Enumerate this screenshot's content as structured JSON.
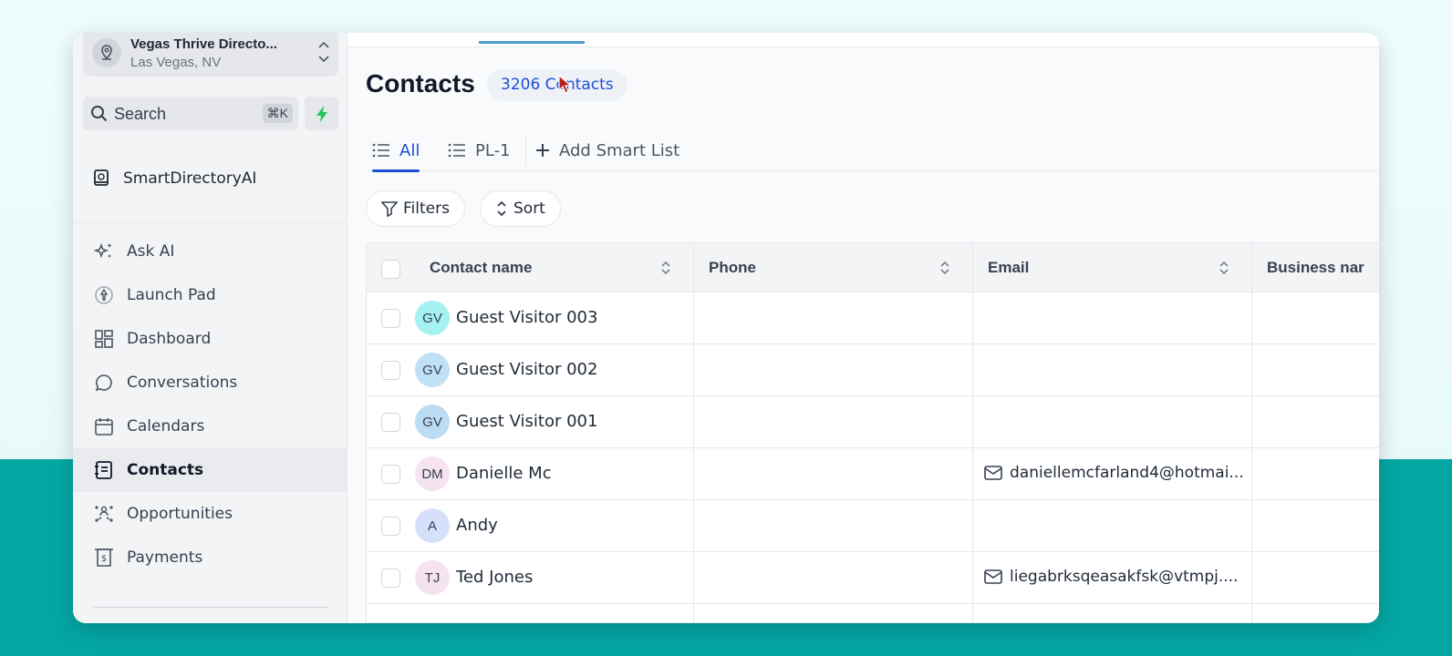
{
  "location": {
    "name": "Vegas Thrive Directo...",
    "city": "Las Vegas, NV"
  },
  "search": {
    "label": "Search",
    "shortcut": "⌘K"
  },
  "directory": {
    "label": "SmartDirectoryAI"
  },
  "nav": [
    {
      "label": "Ask AI",
      "icon": "sparkles-icon"
    },
    {
      "label": "Launch Pad",
      "icon": "rocket-icon"
    },
    {
      "label": "Dashboard",
      "icon": "dashboard-icon"
    },
    {
      "label": "Conversations",
      "icon": "chat-bubble-icon"
    },
    {
      "label": "Calendars",
      "icon": "calendar-icon"
    },
    {
      "label": "Contacts",
      "icon": "contacts-book-icon",
      "active": true
    },
    {
      "label": "Opportunities",
      "icon": "opportunities-icon"
    },
    {
      "label": "Payments",
      "icon": "receipt-dollar-icon"
    }
  ],
  "page": {
    "title": "Contacts",
    "count_label": "3206 Contacts"
  },
  "tabs": [
    {
      "label": "All",
      "icon": "list-icon",
      "active": true
    },
    {
      "label": "PL-1",
      "icon": "list-icon"
    },
    {
      "label": "Add Smart List",
      "icon": "plus-icon"
    }
  ],
  "toolbar": {
    "filters_label": "Filters",
    "sort_label": "Sort"
  },
  "table": {
    "columns": [
      "Contact name",
      "Phone",
      "Email",
      "Business nar"
    ],
    "rows": [
      {
        "initials": "GV",
        "name": "Guest Visitor 003",
        "phone": "",
        "email": "",
        "avatar_color": "#a5f0f0"
      },
      {
        "initials": "GV",
        "name": "Guest Visitor 002",
        "phone": "",
        "email": "",
        "avatar_color": "#bfe0f5"
      },
      {
        "initials": "GV",
        "name": "Guest Visitor 001",
        "phone": "",
        "email": "",
        "avatar_color": "#bcdcf3"
      },
      {
        "initials": "DM",
        "name": "Danielle Mc",
        "phone": "",
        "email": "daniellemcfarland4@hotmai...",
        "avatar_color": "#f6e3f0"
      },
      {
        "initials": "A",
        "name": "Andy",
        "phone": "",
        "email": "",
        "avatar_color": "#d7e0fb"
      },
      {
        "initials": "TJ",
        "name": "Ted Jones",
        "phone": "",
        "email": "liegabrksqeasakfsk@vtmpj....",
        "avatar_color": "#f6e3f0"
      }
    ]
  },
  "colors": {
    "accent": "#1d4ed8",
    "background_band": "#04a6a4",
    "bolt": "#22c55e"
  }
}
